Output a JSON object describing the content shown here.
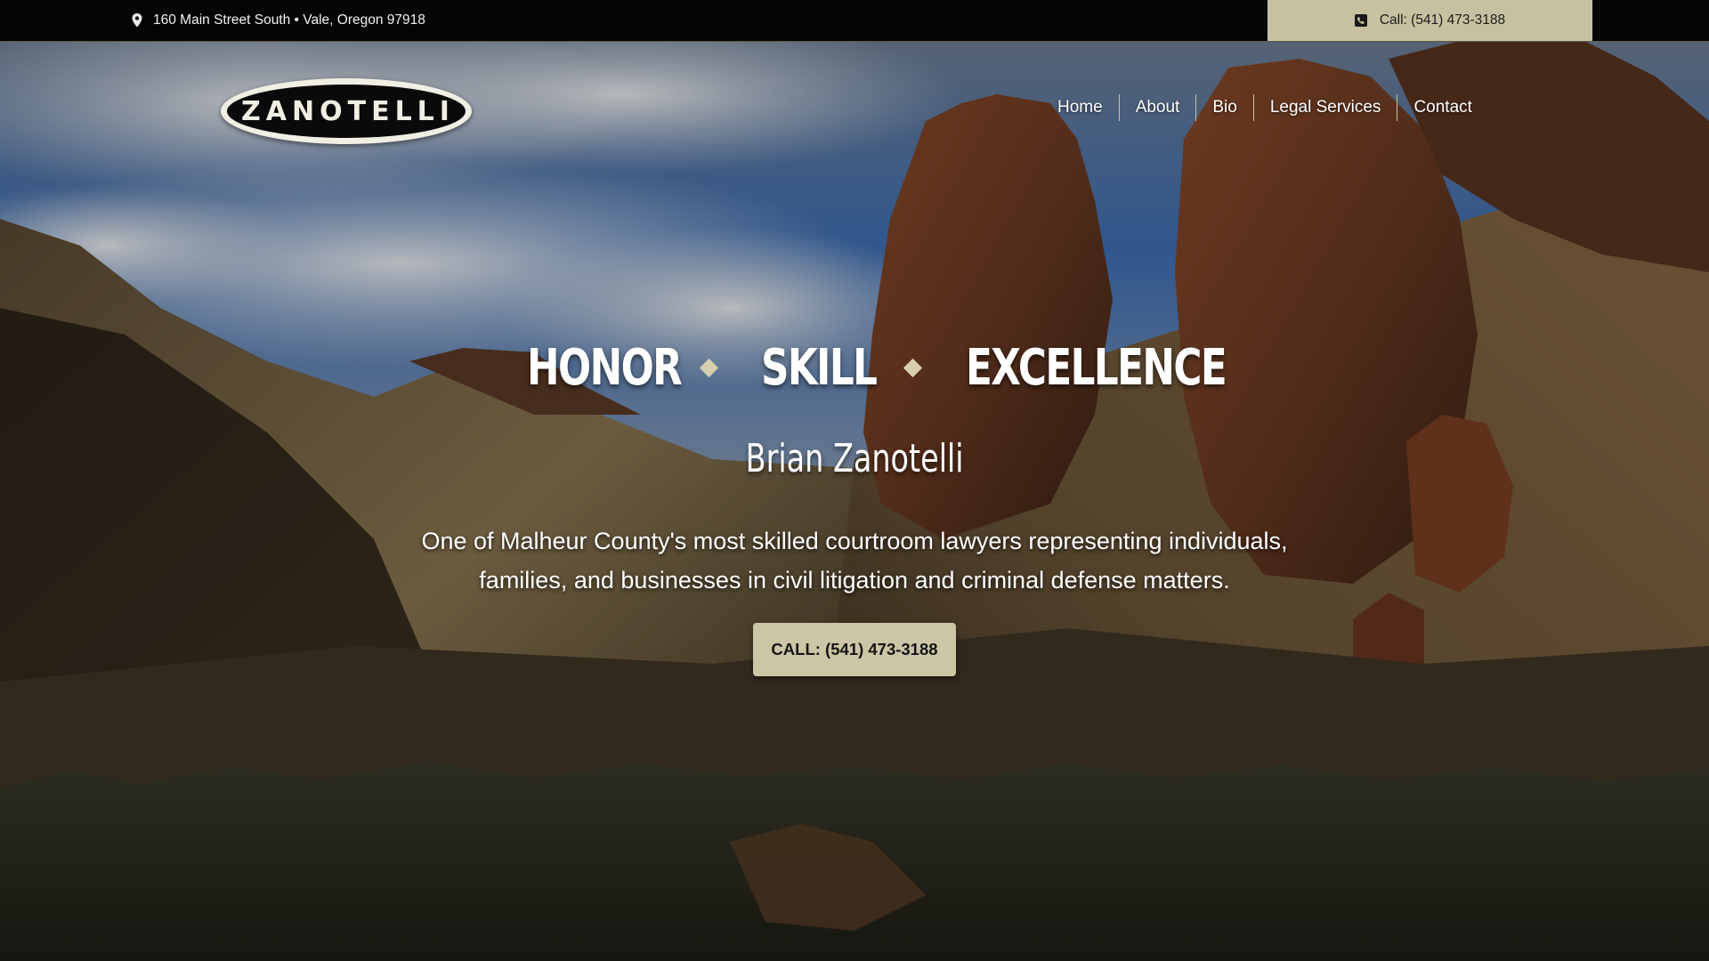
{
  "topbar": {
    "address": "160 Main Street South • Vale, Oregon 97918",
    "address_icon": "map-pin-icon",
    "call_label": "Call: (541) 473-3188",
    "call_icon": "phone-icon",
    "call_bg": "#c8c1a1"
  },
  "header": {
    "logo_text": "ZANOTELLI",
    "nav": [
      {
        "label": "Home"
      },
      {
        "label": "About"
      },
      {
        "label": "Bio"
      },
      {
        "label": "Legal Services"
      },
      {
        "label": "Contact"
      }
    ]
  },
  "hero": {
    "tagline": [
      "HONOR",
      "SKILL",
      "EXCELLENCE"
    ],
    "name": "Brian Zanotelli",
    "blurb_line1": "One of Malheur County's most skilled courtroom lawyers representing individuals,",
    "blurb_line2": "families, and businesses in civil litigation and criminal defense matters.",
    "cta_label": "CALL: (541) 473-3188",
    "accent_color": "#ccc6a6"
  }
}
